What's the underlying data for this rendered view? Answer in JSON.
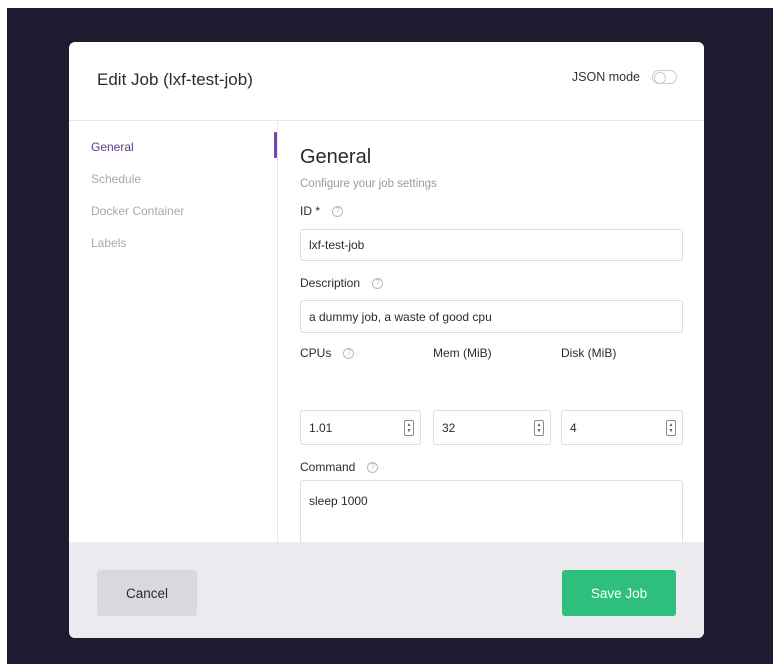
{
  "modal": {
    "title": "Edit Job (lxf-test-job)",
    "json_mode_label": "JSON mode",
    "json_mode_enabled": false
  },
  "sidebar": {
    "items": [
      {
        "label": "General",
        "active": true
      },
      {
        "label": "Schedule",
        "active": false
      },
      {
        "label": "Docker Container",
        "active": false
      },
      {
        "label": "Labels",
        "active": false
      }
    ]
  },
  "general": {
    "title": "General",
    "subtitle": "Configure your job settings",
    "id": {
      "label": "ID *",
      "value": "lxf-test-job"
    },
    "description": {
      "label": "Description",
      "value": "a dummy job, a waste of good cpu"
    },
    "cpus": {
      "label": "CPUs",
      "value": "1.01"
    },
    "mem": {
      "label": "Mem (MiB)",
      "value": "32"
    },
    "disk": {
      "label": "Disk (MiB)",
      "value": "4"
    },
    "command": {
      "label": "Command",
      "value": "sleep 1000"
    }
  },
  "footer": {
    "cancel_label": "Cancel",
    "save_label": "Save Job"
  },
  "colors": {
    "backdrop": "#1c1b30",
    "accent": "#6f4ba0",
    "save": "#2ebf7d"
  }
}
